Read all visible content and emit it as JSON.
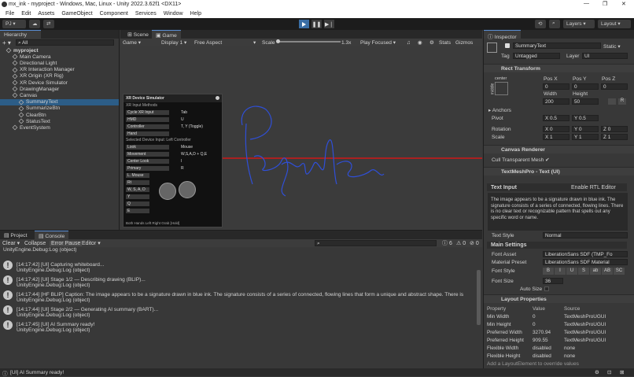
{
  "window": {
    "title": "mx_ink - myproject - Windows, Mac, Linux - Unity 2022.3.62f1 <DX11>",
    "controls": [
      "—",
      "❐",
      "✕"
    ]
  },
  "menu": [
    "File",
    "Edit",
    "Assets",
    "GameObject",
    "Component",
    "Services",
    "Window",
    "Help"
  ],
  "toolbar": {
    "account": "PJ",
    "layers": "Layers",
    "layout": "Layout"
  },
  "hierarchy": {
    "tab": "Hierarchy",
    "search": "All",
    "items": [
      {
        "label": "myproject",
        "depth": 0,
        "bold": true
      },
      {
        "label": "Main Camera",
        "depth": 1
      },
      {
        "label": "Directional Light",
        "depth": 1
      },
      {
        "label": "XR Interaction Manager",
        "depth": 1
      },
      {
        "label": "XR Origin (XR Rig)",
        "depth": 1
      },
      {
        "label": "XR Device Simulator",
        "depth": 1
      },
      {
        "label": "DrawingManager",
        "depth": 1
      },
      {
        "label": "Canvas",
        "depth": 1
      },
      {
        "label": "SummaryText",
        "depth": 2,
        "selected": true
      },
      {
        "label": "SummarizeBtn",
        "depth": 2
      },
      {
        "label": "ClearBtn",
        "depth": 2
      },
      {
        "label": "StatusText",
        "depth": 2
      },
      {
        "label": "EventSystem",
        "depth": 1
      }
    ]
  },
  "center": {
    "tabs": [
      "Scene",
      "Game"
    ],
    "game_bar": {
      "mode": "Game",
      "display": "Display 1",
      "aspect": "Free Aspect",
      "scale_label": "Scale",
      "scale_value": "1.3x",
      "play_mode": "Play Focused",
      "stats": "Stats",
      "gizmos": "Gizmos"
    },
    "simulator": {
      "title": "XR Device Simulator",
      "section1": "XR Input Methods",
      "rows1": [
        {
          "key": "Cycle XR Input",
          "val": "Tab"
        },
        {
          "key": "HMD",
          "val": "U"
        },
        {
          "key": "Controller",
          "val": "T, Y (Toggle)"
        },
        {
          "key": "Hand",
          "val": ""
        }
      ],
      "section2": "Selected Device Input: Left Controller",
      "rows2": [
        {
          "key": "Look",
          "val": "Mouse"
        },
        {
          "key": "Movement",
          "val": "W,S,A,D + Q,E"
        },
        {
          "key": "Center Look",
          "val": "I"
        },
        {
          "key": "Primary",
          "val": "R"
        }
      ],
      "rows3": [
        "L. Mouse",
        "Rt",
        "W, S, A, D",
        "Y",
        "Q",
        "E"
      ],
      "footer": "Both Hands   Left  Right   Grab [Hold]"
    }
  },
  "console": {
    "tabs": [
      "Project",
      "Console"
    ],
    "toolbar": [
      "Clear",
      "Collapse",
      "Error Pause",
      "Editor"
    ],
    "counts": [
      "6",
      "0",
      "0"
    ],
    "logs": [
      {
        "line1": "UnityEngine.Debug:Log (object)",
        "line2": ""
      },
      {
        "line1": "[14:17:42] [UI] Capturing whiteboard...",
        "line2": "UnityEngine.Debug:Log (object)"
      },
      {
        "line1": "[14:17:42] [UI] Stage 1/2 — Describing drawing (BLIP)...",
        "line2": "UnityEngine.Debug:Log (object)"
      },
      {
        "line1": "[14:17:44] [HF BLIP] Caption: The image appears to be a signature drawn in blue ink. The signature consists of a series of connected, flowing lines that form a unique and abstract shape. There is",
        "line2": "UnityEngine.Debug:Log (object)"
      },
      {
        "line1": "[14:17:44] [UI] Stage 2/2 — Generating AI summary (BART)...",
        "line2": "UnityEngine.Debug:Log (object)"
      },
      {
        "line1": "[14:17:45] [UI] AI Summary ready!",
        "line2": "UnityEngine.Debug:Log (object)"
      }
    ]
  },
  "inspector": {
    "tab": "Inspector",
    "object_name": "SummaryText",
    "static": "Static",
    "tag_label": "Tag",
    "tag": "Untagged",
    "layer_label": "Layer",
    "layer": "UI",
    "rect": {
      "title": "Rect Transform",
      "anchor": "center",
      "middle": "middle",
      "pos_x_label": "Pos X",
      "pos_y_label": "Pos Y",
      "pos_z_label": "Pos Z",
      "pos_x": "0",
      "pos_y": "0",
      "pos_z": "0",
      "width_label": "Width",
      "height_label": "Height",
      "width": "200",
      "height": "50",
      "anchors": "Anchors",
      "pivot": "Pivot",
      "pivot_x": "0.5",
      "pivot_y": "0.5",
      "rotation": "Rotation",
      "rot_x": "0",
      "rot_y": "0",
      "rot_z": "0",
      "scale": "Scale",
      "scale_x": "1",
      "scale_y": "1",
      "scale_z": "1"
    },
    "canvas_renderer": {
      "title": "Canvas Renderer",
      "cull": "Cull Transparent Mesh"
    },
    "tmp": {
      "title": "TextMeshPro - Text (UI)",
      "text_input": "Text Input",
      "rtl": "Enable RTL Editor",
      "text": "The image appears to be a signature drawn in blue ink. The signature consists of a series of connected, flowing lines. There is no clear text or recognizable pattern that spells out any specific word or name.",
      "text_style_label": "Text Style",
      "text_style": "Normal",
      "main_settings": "Main Settings",
      "font_asset_label": "Font Asset",
      "font_asset": "LiberationSans SDF (TMP_Fo",
      "material_label": "Material Preset",
      "material": "LiberationSans SDF Material",
      "font_style_label": "Font Style",
      "font_styles": [
        "B",
        "I",
        "U",
        "S",
        "ab",
        "AB",
        "SC"
      ],
      "font_size_label": "Font Size",
      "font_size": "36",
      "auto_size": "Auto Size"
    },
    "layout": {
      "title": "Layout Properties",
      "headers": [
        "Property",
        "Value",
        "Source"
      ],
      "rows": [
        [
          "Min Width",
          "0",
          "TextMeshProUGUI"
        ],
        [
          "Min Height",
          "0",
          "TextMeshProUGUI"
        ],
        [
          "Preferred Width",
          "3270.94",
          "TextMeshProUGUI"
        ],
        [
          "Preferred Height",
          "909.55",
          "TextMeshProUGUI"
        ],
        [
          "Flexible Width",
          "disabled",
          "none"
        ],
        [
          "Flexible Height",
          "disabled",
          "none"
        ]
      ],
      "footer": "Add a LayoutElement to override values"
    }
  },
  "status": {
    "text": "[UI] AI Summary ready!"
  },
  "colors": {
    "accent": "#2c5d87",
    "ink": "#2f4fd8",
    "laser": "#d01818"
  }
}
